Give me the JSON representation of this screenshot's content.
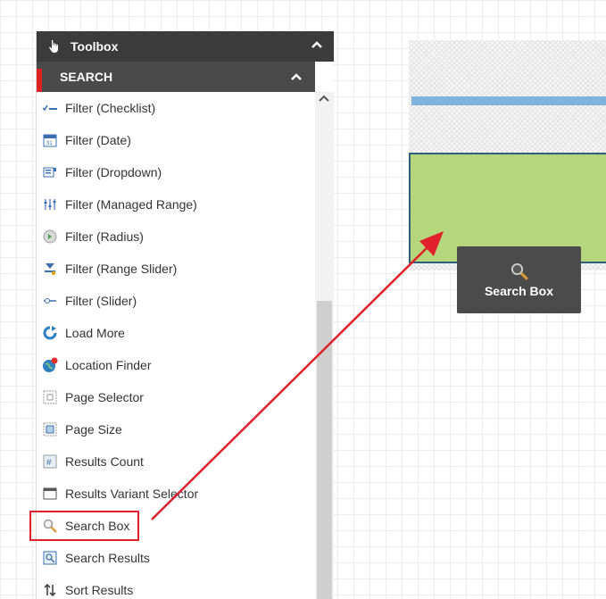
{
  "toolbox": {
    "title": "Toolbox",
    "title_icon": "hand-pointer-icon",
    "collapse_icon": "chevron-up-icon"
  },
  "section": {
    "title": "SEARCH",
    "collapse_icon": "chevron-up-icon",
    "accent_color": "#e02020"
  },
  "items": [
    {
      "label": "Filter (Checklist)",
      "icon": "checklist-icon"
    },
    {
      "label": "Filter (Date)",
      "icon": "calendar-icon"
    },
    {
      "label": "Filter (Dropdown)",
      "icon": "dropdown-icon"
    },
    {
      "label": "Filter (Managed Range)",
      "icon": "range-sliders-icon"
    },
    {
      "label": "Filter (Radius)",
      "icon": "radius-icon"
    },
    {
      "label": "Filter (Range Slider)",
      "icon": "range-slider-icon"
    },
    {
      "label": "Filter (Slider)",
      "icon": "slider-icon"
    },
    {
      "label": "Load More",
      "icon": "refresh-icon"
    },
    {
      "label": "Location Finder",
      "icon": "globe-pin-icon"
    },
    {
      "label": "Page Selector",
      "icon": "page-selector-icon"
    },
    {
      "label": "Page Size",
      "icon": "page-size-icon"
    },
    {
      "label": "Results Count",
      "icon": "hash-icon"
    },
    {
      "label": "Results Variant Selector",
      "icon": "window-icon"
    },
    {
      "label": "Search Box",
      "icon": "magnifier-icon"
    },
    {
      "label": "Search Results",
      "icon": "search-results-icon"
    },
    {
      "label": "Sort Results",
      "icon": "sort-icon"
    }
  ],
  "highlighted_item": "Search Box",
  "drag_tile": {
    "label": "Search Box",
    "icon": "magnifier-icon"
  },
  "colors": {
    "drop_zone": "#b5d67c",
    "drop_zone_border": "#2f5f7a",
    "placeholder_bar": "#7fb3dc",
    "arrow": "#e0202a",
    "header_bg": "#3b3b3b"
  }
}
